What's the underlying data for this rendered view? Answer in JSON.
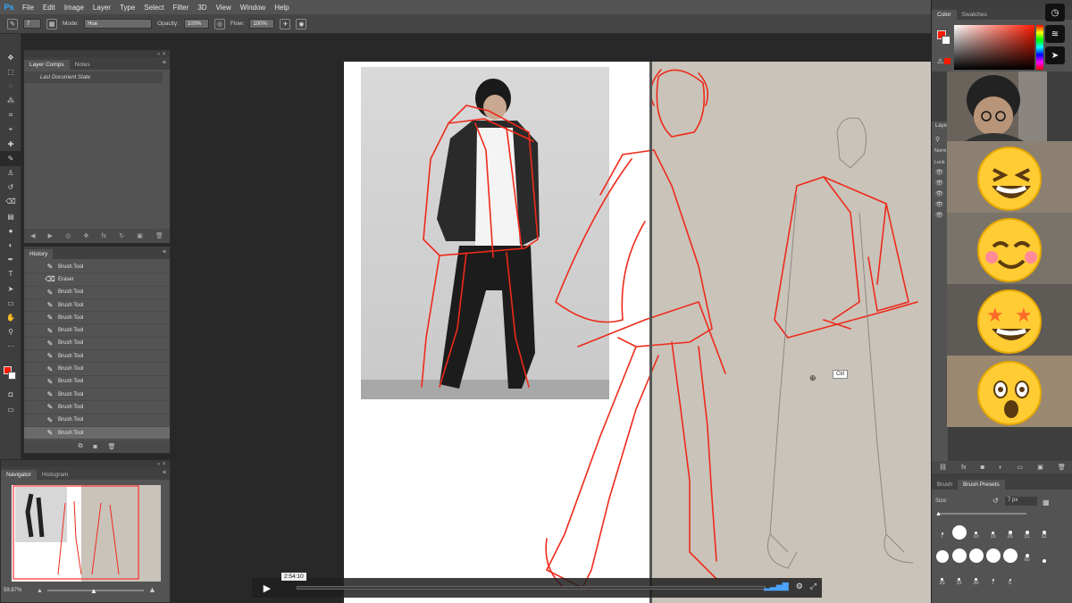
{
  "app": {
    "logo": "Ps"
  },
  "menu": [
    "File",
    "Edit",
    "Image",
    "Layer",
    "Type",
    "Select",
    "Filter",
    "3D",
    "View",
    "Window",
    "Help"
  ],
  "options_bar": {
    "brush_size": "7",
    "mode_label": "Mode:",
    "mode_value": "Hue",
    "opacity_label": "Opacity:",
    "opacity_value": "100%",
    "flow_label": "Flow:",
    "flow_value": "100%"
  },
  "layer_comps_panel": {
    "tabs": [
      "Layer Comps",
      "Notes"
    ],
    "items": [
      "Last Document State"
    ]
  },
  "history_panel": {
    "title": "History",
    "items": [
      "Brush Tool",
      "Eraser",
      "Brush Tool",
      "Brush Tool",
      "Brush Tool",
      "Brush Tool",
      "Brush Tool",
      "Brush Tool",
      "Brush Tool",
      "Brush Tool",
      "Brush Tool",
      "Brush Tool",
      "Brush Tool",
      "Brush Tool"
    ]
  },
  "navigator_panel": {
    "tabs": [
      "Navigator",
      "Histogram"
    ],
    "zoom": "59.87%"
  },
  "canvas": {
    "tooltip": "Ctrl"
  },
  "video": {
    "time": "2:54:10"
  },
  "right_panels": {
    "color_tabs": [
      "Color",
      "Swatches"
    ],
    "layers_tab_partial": "Laye",
    "layers_mode_partial": "Norm",
    "layers_lock_partial": "Lock",
    "brush_tabs": [
      "Brush",
      "Brush Presets"
    ],
    "size_label": "Size:",
    "size_value": "7 px",
    "brush_preset_sizes_row1": [
      "7",
      "",
      "10",
      "15",
      "26",
      "31",
      "32"
    ],
    "brush_preset_sizes_row3": [
      "20",
      "15",
      "30",
      "7",
      "5"
    ],
    "brush_preset_sizes_row2_end": "60"
  },
  "reactions": {
    "emojis": [
      "grinning-squinting",
      "smiling-blush",
      "star-struck",
      "astonished"
    ]
  },
  "colors": {
    "foreground": "#ff1a00",
    "background": "#ffffff",
    "sketch_red": "#ee2a1a",
    "panel": "#535353"
  }
}
